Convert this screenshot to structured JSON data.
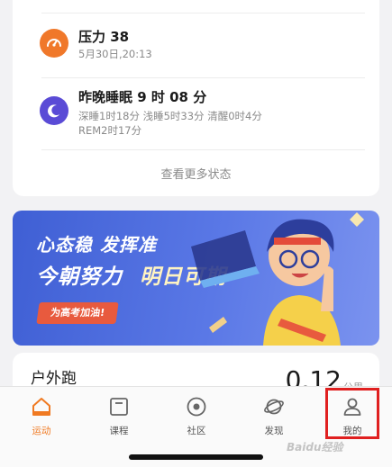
{
  "status_card": {
    "items": [
      {
        "title": "压力 38",
        "subtitle": "5月30日,20:13",
        "icon": "gauge-icon",
        "icon_color": "#f0782a"
      },
      {
        "title": "昨晚睡眠 9 时 08 分",
        "subtitle_line1": "深睡1时18分 浅睡5时33分 清醒0时4分",
        "subtitle_line2": "REM2时17分",
        "icon": "moon-icon",
        "icon_color": "#5a4bd6"
      }
    ],
    "more_label": "查看更多状态"
  },
  "banner": {
    "line1": "心态稳 发挥准",
    "line2_a": "今朝努力",
    "line2_b": "明日可期",
    "tag": "为高考加油!"
  },
  "run_card": {
    "title": "户外跑",
    "value": "0.12",
    "unit": "公里"
  },
  "tabbar": {
    "tabs": [
      {
        "label": "运动",
        "icon": "home-icon",
        "active": true
      },
      {
        "label": "课程",
        "icon": "course-icon",
        "active": false
      },
      {
        "label": "社区",
        "icon": "community-icon",
        "active": false
      },
      {
        "label": "发现",
        "icon": "discover-icon",
        "active": false
      },
      {
        "label": "我的",
        "icon": "profile-icon",
        "active": false
      }
    ]
  },
  "watermark": "Baidu经验",
  "colors": {
    "accent": "#f07a22",
    "highlight": "#e02020"
  }
}
